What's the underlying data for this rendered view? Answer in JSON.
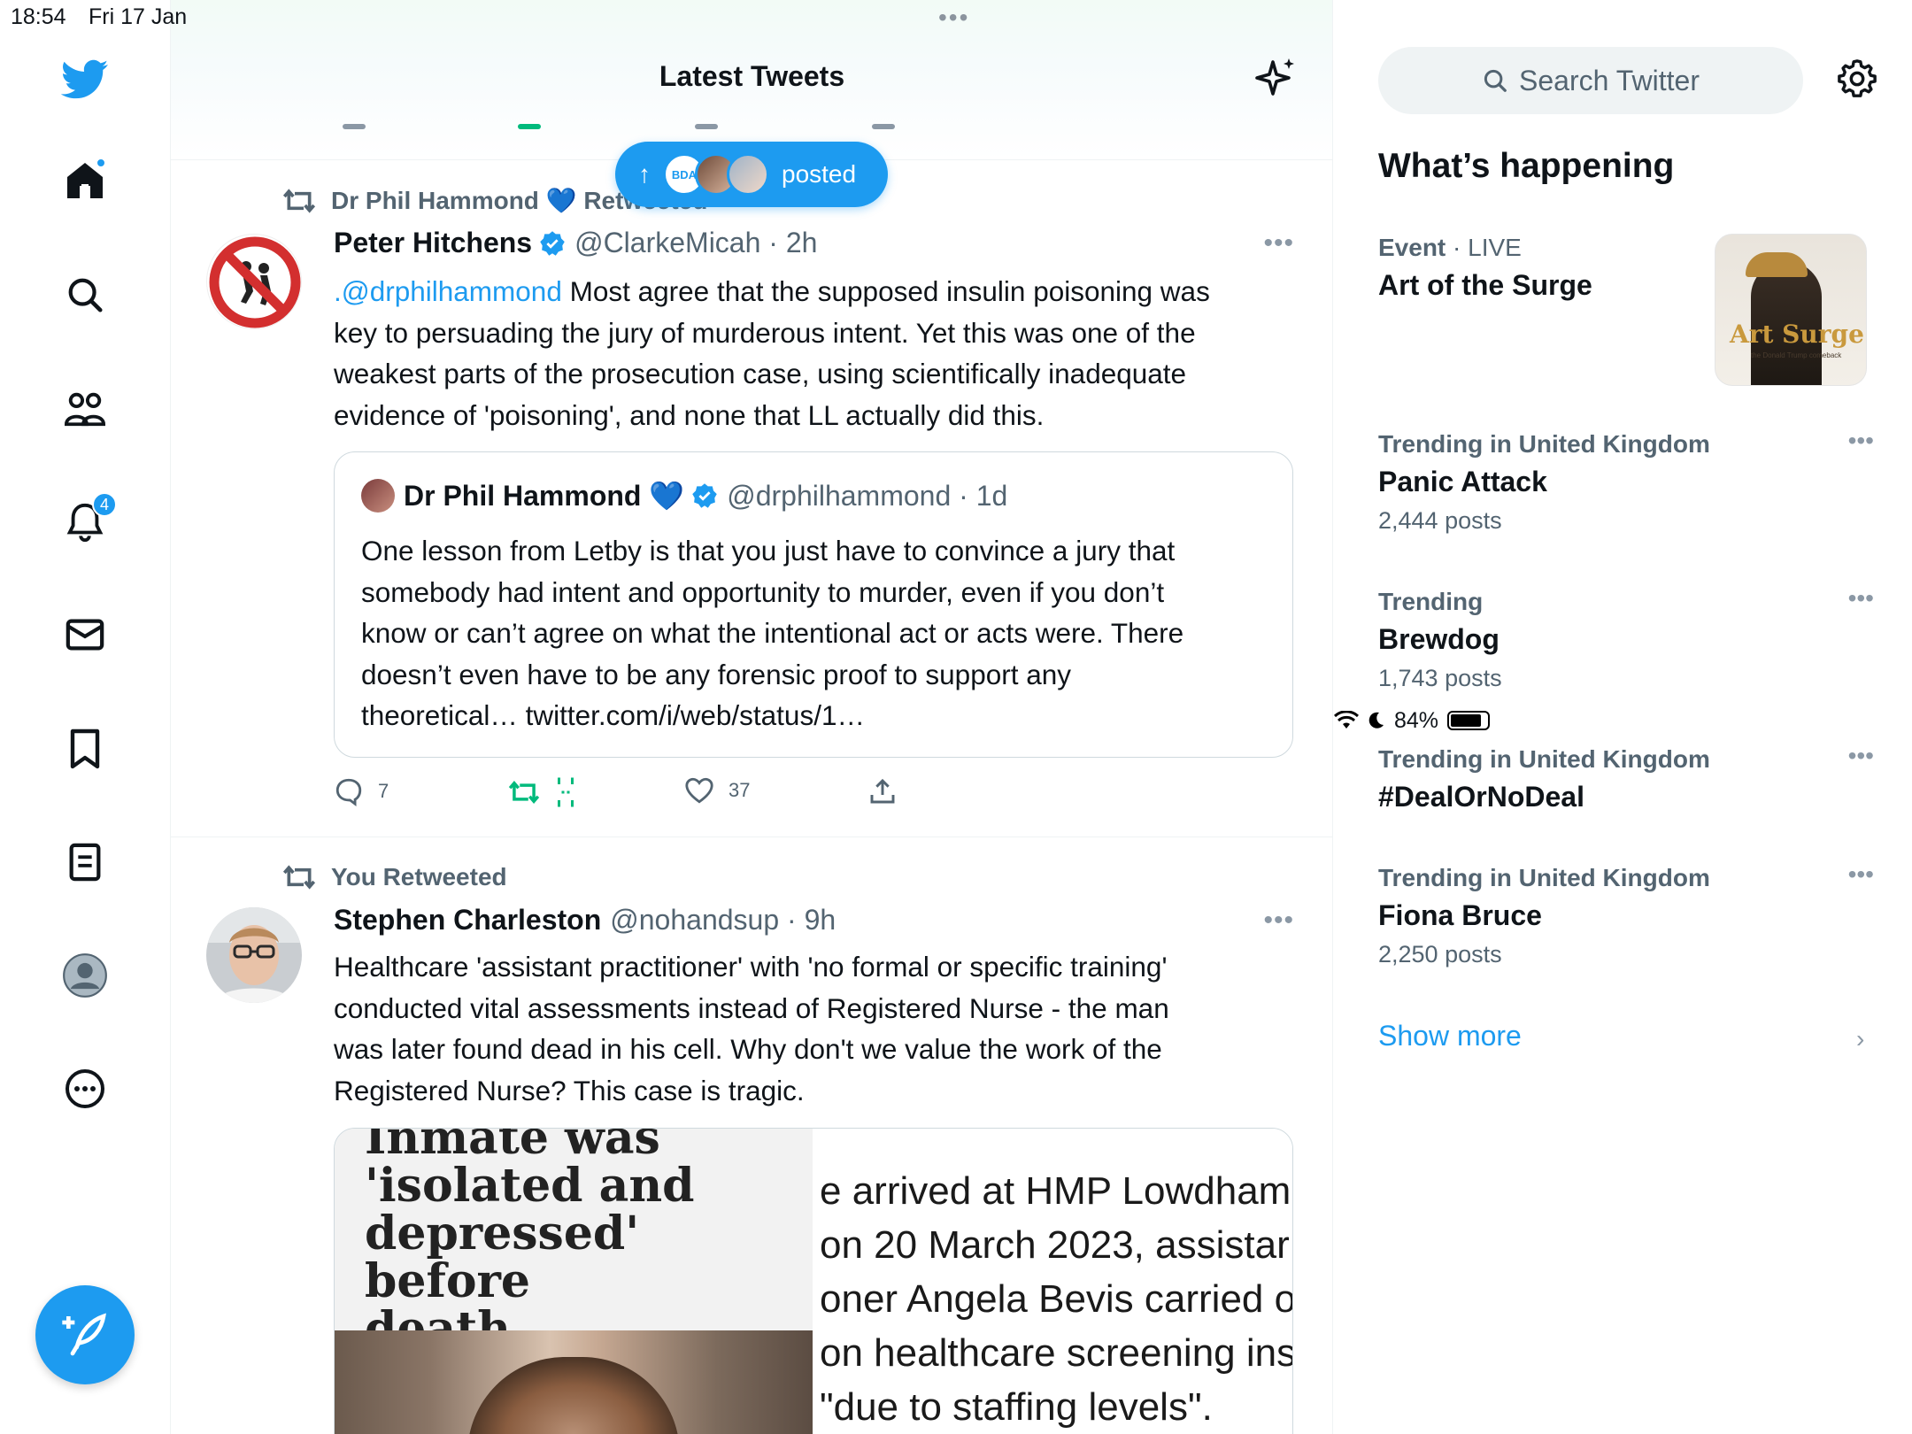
{
  "status_bar": {
    "time": "18:54",
    "date": "Fri 17 Jan",
    "battery": "84%",
    "battery_level": 0.84
  },
  "nav": {
    "home_has_dot": true,
    "notifications_badge": "4",
    "icons": [
      "twitter-logo",
      "home-icon",
      "search-icon",
      "communities-icon",
      "bell-icon",
      "mail-icon",
      "bookmark-icon",
      "lists-icon",
      "profile-icon",
      "more-icon",
      "compose-icon"
    ]
  },
  "timeline": {
    "title": "Latest Tweets",
    "new_posts_label": "posted",
    "new_posts_avatar_text": "BDA"
  },
  "tweets": [
    {
      "retweeted_by": "Dr Phil Hammond 💙 Retweeted",
      "name": "Peter Hitchens",
      "handle": "@ClarkeMicah · 2h",
      "mention": ".@drphilhammond",
      "lines": [
        " Most agree that the supposed insulin poisoning was",
        "key to persuading the jury of murderous intent. Yet this was one of the",
        "weakest parts of the prosecution case, using scientifically inadequate",
        "evidence of 'poisoning', and none that LL actually did this."
      ],
      "quote": {
        "name": "Dr Phil Hammond 💙",
        "handle": "@drphilhammond · 1d",
        "lines": [
          "One lesson from Letby is that you just have to convince a jury that",
          "somebody had intent and opportunity to murder, even if you don’t",
          "know or can’t agree on what the intentional act or acts were. There",
          "doesn’t even have to be any forensic proof to support any",
          "theoretical… twitter.com/i/web/status/1…"
        ]
      },
      "replies": "7",
      "likes": "37"
    },
    {
      "retweeted_by": "You Retweeted",
      "name": "Stephen Charleston",
      "handle": "@nohandsup · 9h",
      "lines": [
        "Healthcare 'assistant practitioner' with 'no formal or specific training'",
        "conducted vital assessments instead of Registered Nurse - the man",
        "was later found dead in his cell. Why don't we value the work of the",
        "Registered Nurse? This case is tragic."
      ],
      "media": {
        "headline_lines": [
          "Inmate was",
          "'isolated and",
          "depressed' before",
          "death"
        ],
        "article_lines": [
          "e arrived at HMP Lowdham",
          " on 20 March 2023, assistar",
          "oner Angela Bevis carried o",
          "on healthcare screening ins",
          " \"due to staffing levels\"."
        ]
      }
    }
  ],
  "sidebar": {
    "search_placeholder": "Search Twitter",
    "section_title": "What’s happening",
    "event": {
      "category": "Event",
      "live": " · LIVE",
      "topic": "Art of the Surge",
      "image_text": "Art Surge",
      "image_sub": "the Donald Trump comeback"
    },
    "trends": [
      {
        "meta": "Trending in United Kingdom",
        "topic": "Panic Attack",
        "count": "2,444 posts"
      },
      {
        "meta": "Trending",
        "topic": "Brewdog",
        "count": "1,743 posts"
      },
      {
        "meta": "Trending in United Kingdom",
        "topic": "#DealOrNoDeal",
        "count": ""
      },
      {
        "meta": "Trending in United Kingdom",
        "topic": "Fiona Bruce",
        "count": "2,250 posts"
      }
    ],
    "show_more": "Show more"
  },
  "colors": {
    "accent": "#1d9bf0",
    "text": "#0f1419",
    "secondary": "#536471",
    "retweet_green": "#00ba7c"
  }
}
